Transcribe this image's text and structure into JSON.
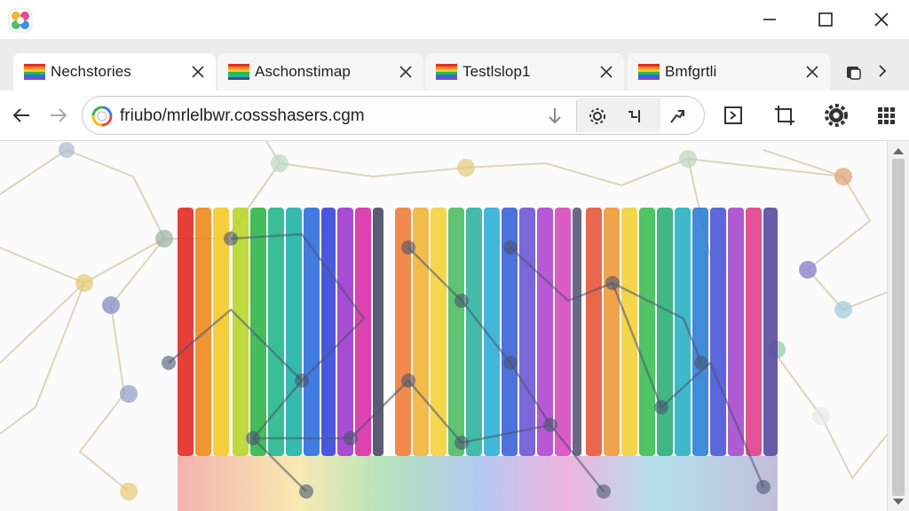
{
  "window": {
    "controls": {
      "minimize": "minimize-icon",
      "maximize": "maximize-icon",
      "close": "close-icon"
    }
  },
  "tabs": [
    {
      "label": "Nechstories",
      "active": true
    },
    {
      "label": "Aschonstimap",
      "active": false
    },
    {
      "label": "Testlslop1",
      "active": false
    },
    {
      "label": "Bmfgrtli",
      "active": false
    }
  ],
  "toolbar": {
    "url": "friubo/mrlelbwr.cossshasers.cgm",
    "icons": [
      "back-arrow-icon",
      "forward-arrow-icon",
      "download-icon",
      "settings-gear-icon",
      "extension-icon",
      "share-icon",
      "reader-icon",
      "crop-icon",
      "settings-icon",
      "apps-grid-icon"
    ]
  },
  "content": {
    "description_colors": [
      "#e52b24",
      "#f08a1e",
      "#f6c928",
      "#31b64a",
      "#20b3a8",
      "#2e6fdc",
      "#8e3fd0",
      "#d92fa8",
      "#4a4a88"
    ]
  }
}
